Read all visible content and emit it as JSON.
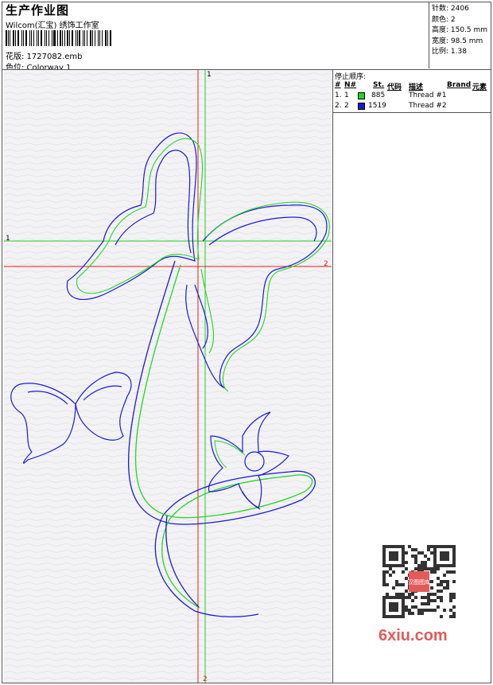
{
  "header": {
    "title": "生产作业图",
    "company": "Wilcom(汇宝) 绣饰工作室",
    "design": "花版: 1727082.emb",
    "colorway": "色位: Colorway 1"
  },
  "stats": {
    "stitches": "针数: 2406",
    "colors": "颜色: 2",
    "height": "高度: 150.5 mm",
    "width": "宽度: 98.5 mm",
    "scale": "比例: 1.38"
  },
  "thread_panel": {
    "title": "停止顺序:",
    "headers": {
      "hash": "#",
      "n": "N#",
      "st": "St.",
      "code": "代码",
      "desc": "描述",
      "brand": "Brand",
      "element": "元素"
    },
    "rows": [
      {
        "idx": "1.",
        "n": "1",
        "swatch": "#22d622",
        "code": "885",
        "desc": "Thread #1"
      },
      {
        "idx": "2.",
        "n": "2",
        "swatch": "#1a1ad6",
        "code": "1519",
        "desc": "Thread #2"
      }
    ]
  },
  "guides": {
    "green_label_top": "1",
    "green_label_left": "1",
    "red_label_right": "2",
    "red_label_bottom": "2"
  },
  "colors": {
    "thread1": "#22d622",
    "thread2": "#1a1ad6",
    "guide_green": "#22cc22",
    "guide_red": "#e02020"
  },
  "watermark": {
    "text": "6xiu.com",
    "stamp": "汉图图库"
  }
}
